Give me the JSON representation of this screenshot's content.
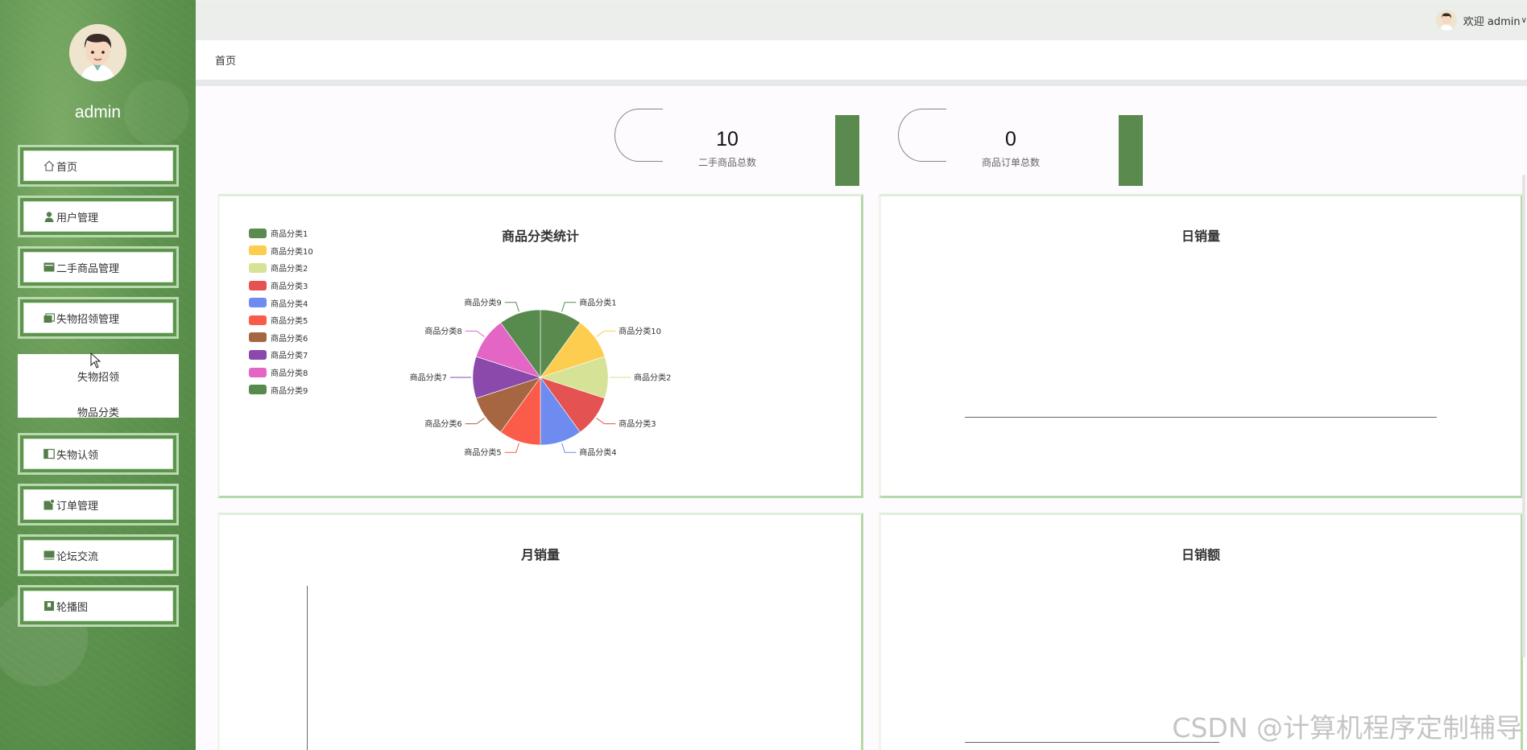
{
  "user": {
    "name": "admin",
    "welcome": "欢迎 admin"
  },
  "sidebar": {
    "items": [
      {
        "label": "首页",
        "icon": "home-icon"
      },
      {
        "label": "用户管理",
        "icon": "user-icon"
      },
      {
        "label": "二手商品管理",
        "icon": "goods-icon"
      },
      {
        "label": "失物招领管理",
        "icon": "folder-icon"
      },
      {
        "label": "失物认领",
        "icon": "book-icon"
      },
      {
        "label": "订单管理",
        "icon": "order-icon"
      },
      {
        "label": "论坛交流",
        "icon": "forum-icon"
      },
      {
        "label": "轮播图",
        "icon": "bookmark-icon"
      }
    ],
    "submenu": [
      "失物招领",
      "物品分类"
    ]
  },
  "breadcrumb": "首页",
  "stats": [
    {
      "value": "10",
      "label": "二手商品总数"
    },
    {
      "value": "0",
      "label": "商品订单总数"
    }
  ],
  "panels": {
    "category": "商品分类统计",
    "daily_sales": "日销量",
    "monthly_sales": "月销量",
    "daily_revenue": "日销额"
  },
  "watermark": "CSDN @计算机程序定制辅导",
  "chart_data": [
    {
      "type": "pie",
      "title": "商品分类统计",
      "legend": "left",
      "slices": [
        {
          "name": "商品分类1",
          "value": 1,
          "color": "#5a8a4e"
        },
        {
          "name": "商品分类10",
          "value": 1,
          "color": "#fdcd4f"
        },
        {
          "name": "商品分类2",
          "value": 1,
          "color": "#d6e296"
        },
        {
          "name": "商品分类3",
          "value": 1,
          "color": "#e45252"
        },
        {
          "name": "商品分类4",
          "value": 1,
          "color": "#6e8cf0"
        },
        {
          "name": "商品分类5",
          "value": 1,
          "color": "#fb5b49"
        },
        {
          "name": "商品分类6",
          "value": 1,
          "color": "#a76642"
        },
        {
          "name": "商品分类7",
          "value": 1,
          "color": "#8a49ab"
        },
        {
          "name": "商品分类8",
          "value": 1,
          "color": "#e366c4"
        },
        {
          "name": "商品分类9",
          "value": 1,
          "color": "#578a4d"
        }
      ]
    },
    {
      "type": "line",
      "title": "日销量",
      "series": []
    },
    {
      "type": "bar",
      "title": "月销量",
      "series": []
    },
    {
      "type": "line",
      "title": "日销额",
      "series": []
    }
  ]
}
